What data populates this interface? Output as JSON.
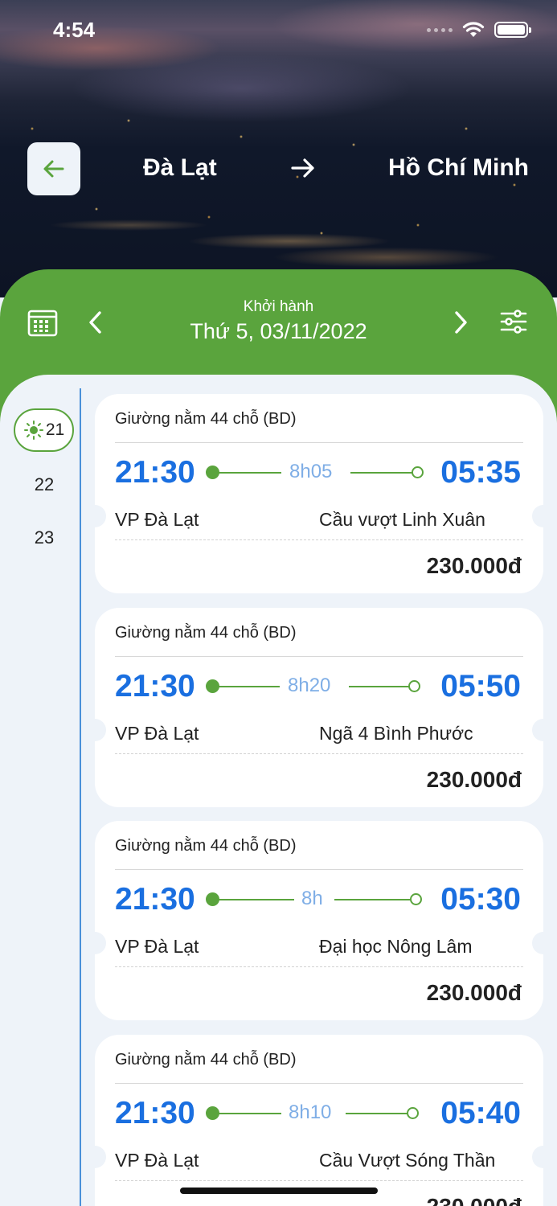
{
  "status_bar": {
    "time": "4:54"
  },
  "header": {
    "from_city": "Đà Lạt",
    "to_city": "Hồ Chí Minh"
  },
  "date_bar": {
    "label": "Khởi hành",
    "date": "Thứ 5, 03/11/2022"
  },
  "hours": {
    "active": "21",
    "items": [
      "22",
      "23"
    ]
  },
  "trips": [
    {
      "type": "Giường nằm 44 chỗ (BD)",
      "depart": "21:30",
      "arrive": "05:35",
      "duration": "8h05",
      "from": "VP Đà Lạt",
      "to": "Cầu vượt Linh Xuân",
      "price": "230.000đ"
    },
    {
      "type": "Giường nằm 44 chỗ (BD)",
      "depart": "21:30",
      "arrive": "05:50",
      "duration": "8h20",
      "from": "VP Đà Lạt",
      "to": "Ngã 4 Bình Phước",
      "price": "230.000đ"
    },
    {
      "type": "Giường nằm 44 chỗ (BD)",
      "depart": "21:30",
      "arrive": "05:30",
      "duration": "8h",
      "from": "VP Đà Lạt",
      "to": "Đại học Nông Lâm",
      "price": "230.000đ"
    },
    {
      "type": "Giường nằm 44 chỗ (BD)",
      "depart": "21:30",
      "arrive": "05:40",
      "duration": "8h10",
      "from": "VP Đà Lạt",
      "to": "Cầu Vượt Sóng Thần",
      "price": "230.000đ"
    }
  ],
  "colors": {
    "primary_green": "#5aa43d",
    "time_blue": "#1a6fe0",
    "duration_blue": "#7faee6",
    "background": "#eef3f9"
  }
}
